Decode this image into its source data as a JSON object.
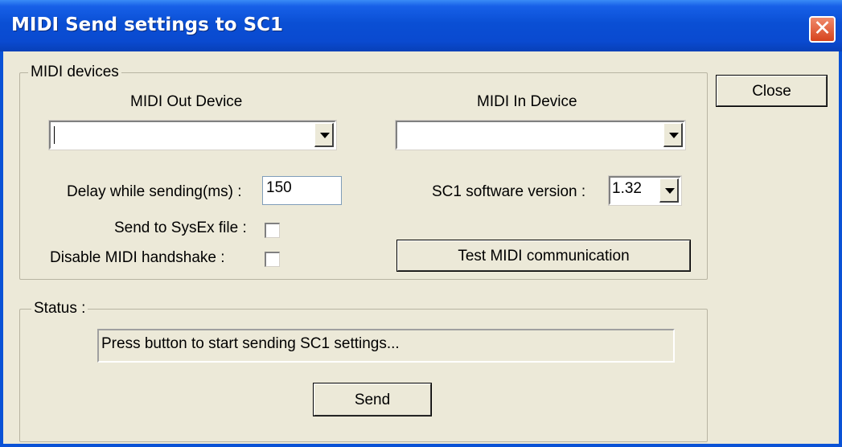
{
  "window": {
    "title": "MIDI Send settings to SC1",
    "close_glyph": "✕"
  },
  "midi_devices": {
    "legend": "MIDI devices",
    "out_label": "MIDI Out Device",
    "out_value": "",
    "in_label": "MIDI In Device",
    "in_value": "",
    "delay_label": "Delay while sending(ms) :",
    "delay_value": "150",
    "sysex_label": "Send to SysEx file :",
    "handshake_label": "Disable MIDI handshake  :",
    "version_label": "SC1 software version :",
    "version_value": "1.32",
    "test_button": "Test MIDI communication"
  },
  "status": {
    "legend": "Status :",
    "message": "Press button to start sending SC1 settings...",
    "send_button": "Send"
  },
  "close_button": "Close"
}
